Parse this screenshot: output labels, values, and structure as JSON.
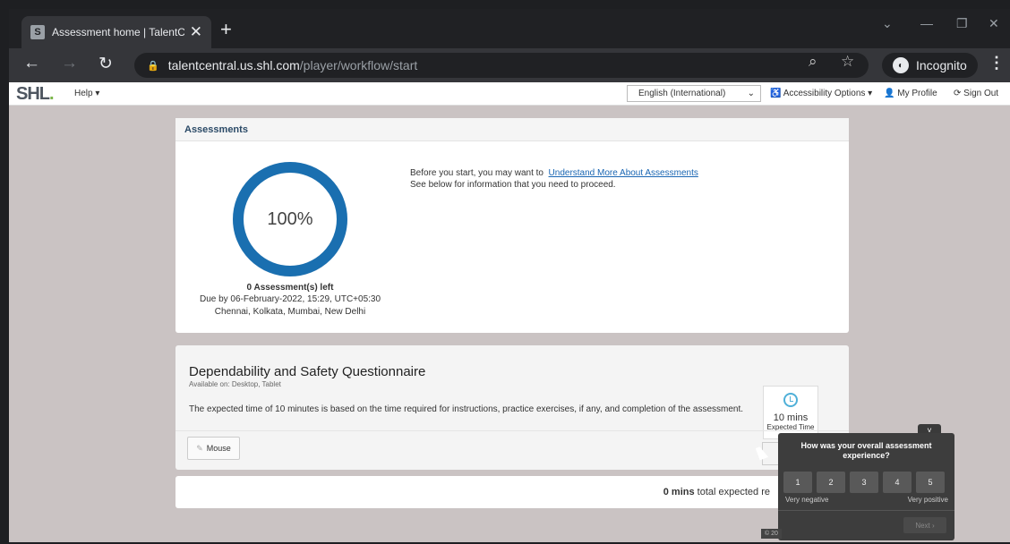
{
  "browser": {
    "tab_title": "Assessment home | TalentCent",
    "favicon_letter": "S",
    "new_tab": "+",
    "close_tab": "✕",
    "url_host": "talentcentral.us.shl.com",
    "url_path": "/player/workflow/start",
    "incognito_label": "Incognito"
  },
  "site": {
    "logo": "SHL",
    "help": "Help ▾",
    "language": "English (International)",
    "accessibility": "Accessibility Options ▾",
    "profile": "My Profile",
    "signout": "Sign Out"
  },
  "assessments": {
    "header": "Assessments",
    "progress_label": "100%",
    "progress_fraction": 1.0,
    "left_count": "0 Assessment(s) left",
    "due": "Due by 06-February-2022, 15:29, UTC+05:30",
    "timezone": "Chennai, Kolkata, Mumbai, New Delhi",
    "intro_prefix": "Before you start, you may want to",
    "intro_link": "Understand More About Assessments",
    "intro_line2": "See below for information that you need to proceed."
  },
  "course": {
    "title": "Dependability and Safety Questionnaire",
    "available": "Available on:  Desktop, Tablet",
    "description": "The expected time of 10 minutes is based on the time required for instructions, practice exercises, if any, and completion of the assessment.",
    "time_value": "10 mins",
    "time_label": "Expected Time",
    "mouse_label": "Mouse"
  },
  "summary": {
    "mins_bold": "0 mins",
    "mins_rest": " total expected re"
  },
  "feedback": {
    "question": "How was your overall assessment experience?",
    "options": [
      "1",
      "2",
      "3",
      "4",
      "5"
    ],
    "negative": "Very negative",
    "positive": "Very positive",
    "next": "Next",
    "toggle": "˅",
    "copyright": "© 20"
  },
  "colors": {
    "ring": "#1a6fb0",
    "page_bg": "#cac3c3"
  }
}
